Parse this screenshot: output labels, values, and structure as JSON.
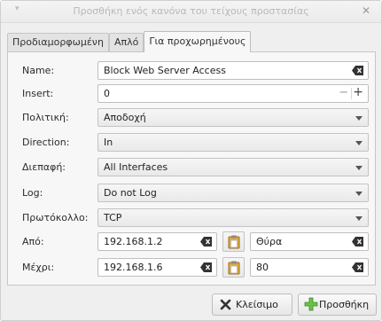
{
  "window": {
    "title": "Προσθήκη ενός κανόνα του τείχους προστασίας"
  },
  "tabs": [
    {
      "label": "Προδιαμορφωμένη"
    },
    {
      "label": "Απλό"
    },
    {
      "label": "Για προχωρημένους"
    }
  ],
  "form": {
    "name": {
      "label": "Name:",
      "value": "Block Web Server Access"
    },
    "insert": {
      "label": "Insert:",
      "value": "0",
      "minus": "−",
      "plus": "+"
    },
    "policy": {
      "label": "Πολιτική:",
      "value": "Αποδοχή"
    },
    "direction": {
      "label": "Direction:",
      "value": "In"
    },
    "interface": {
      "label": "Διεπαφή:",
      "value": "All Interfaces"
    },
    "log": {
      "label": "Log:",
      "value": "Do not Log"
    },
    "protocol": {
      "label": "Πρωτόκολλο:",
      "value": "TCP"
    },
    "from": {
      "label": "Από:",
      "address": "192.168.1.2",
      "port_placeholder": "Θύρα",
      "port": ""
    },
    "to": {
      "label": "Μέχρι:",
      "address": "192.168.1.6",
      "port": "80"
    }
  },
  "buttons": {
    "close": {
      "label": "Κλείσιμο"
    },
    "add": {
      "label": "Προσθήκη"
    }
  },
  "colors": {
    "add_icon": "#5cb85c",
    "close_icon": "#333333",
    "paste_icon": "#e0a93c"
  }
}
